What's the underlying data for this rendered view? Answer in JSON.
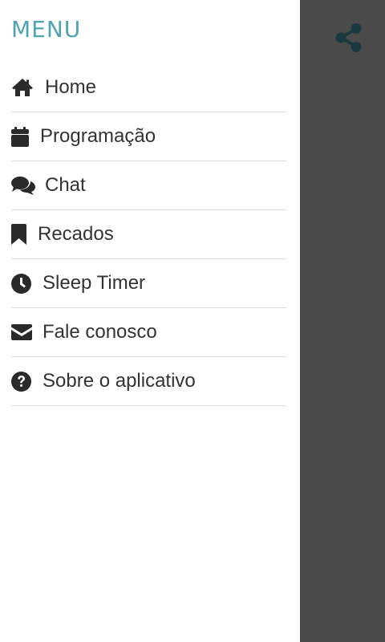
{
  "menu": {
    "title": "MENU",
    "items": [
      {
        "label": "Home",
        "icon": "home-icon"
      },
      {
        "label": "Programação",
        "icon": "calendar-icon"
      },
      {
        "label": "Chat",
        "icon": "comments-icon"
      },
      {
        "label": "Recados",
        "icon": "bookmark-icon"
      },
      {
        "label": "Sleep Timer",
        "icon": "clock-icon"
      },
      {
        "label": "Fale conosco",
        "icon": "envelope-icon"
      },
      {
        "label": "Sobre o aplicativo",
        "icon": "question-circle-icon"
      }
    ]
  },
  "topbar": {
    "share_icon": "share-icon"
  },
  "colors": {
    "accent": "#4fa3b2",
    "overlay": "#4a4a4a",
    "share_icon": "#1a3a40",
    "text": "#333333"
  }
}
